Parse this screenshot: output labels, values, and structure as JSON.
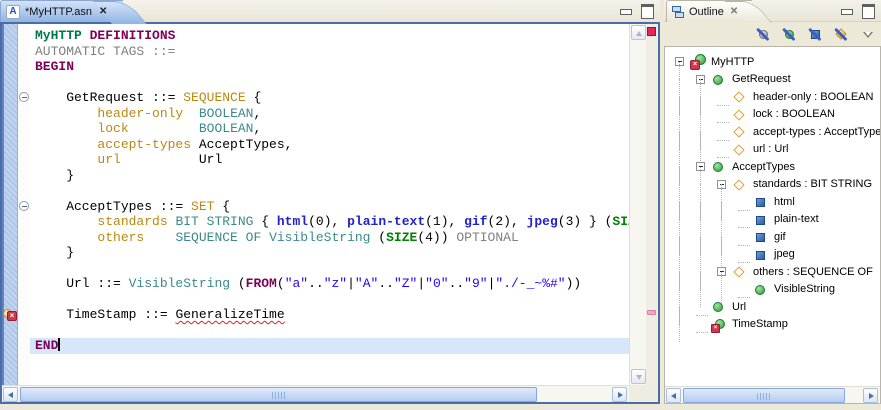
{
  "editor": {
    "tab_title": "*MyHTTP.asn",
    "file_icon_letter": "A",
    "current_line": 20,
    "fold_lines": [
      4,
      11
    ],
    "error_line": 18,
    "code_lines": [
      [
        [
          "mod",
          "MyHTTP"
        ],
        [
          "plain",
          " "
        ],
        [
          "kw",
          "DEFINITIONS"
        ]
      ],
      [
        [
          "gray",
          "AUTOMATIC TAGS ::="
        ]
      ],
      [
        [
          "kw",
          "BEGIN"
        ]
      ],
      [],
      [
        [
          "plain",
          "    GetRequest ::= "
        ],
        [
          "field",
          "SEQUENCE"
        ],
        [
          "plain",
          " {"
        ]
      ],
      [
        [
          "plain",
          "        "
        ],
        [
          "field",
          "header-only"
        ],
        [
          "plain",
          "  "
        ],
        [
          "type",
          "BOOLEAN"
        ],
        [
          "plain",
          ","
        ]
      ],
      [
        [
          "plain",
          "        "
        ],
        [
          "field",
          "lock"
        ],
        [
          "plain",
          "         "
        ],
        [
          "type",
          "BOOLEAN"
        ],
        [
          "plain",
          ","
        ]
      ],
      [
        [
          "plain",
          "        "
        ],
        [
          "field",
          "accept-types"
        ],
        [
          "plain",
          " AcceptTypes,"
        ]
      ],
      [
        [
          "plain",
          "        "
        ],
        [
          "field",
          "url"
        ],
        [
          "plain",
          "          Url"
        ]
      ],
      [
        [
          "plain",
          "    }"
        ]
      ],
      [],
      [
        [
          "plain",
          "    AcceptTypes ::= "
        ],
        [
          "field",
          "SET"
        ],
        [
          "plain",
          " {"
        ]
      ],
      [
        [
          "plain",
          "        "
        ],
        [
          "field",
          "standards"
        ],
        [
          "plain",
          " "
        ],
        [
          "type",
          "BIT STRING"
        ],
        [
          "plain",
          " { "
        ],
        [
          "val",
          "html"
        ],
        [
          "plain",
          "(0), "
        ],
        [
          "val",
          "plain-text"
        ],
        [
          "plain",
          "(1), "
        ],
        [
          "val",
          "gif"
        ],
        [
          "plain",
          "(2), "
        ],
        [
          "val",
          "jpeg"
        ],
        [
          "plain",
          "(3) } ("
        ],
        [
          "size",
          "SIZE"
        ],
        [
          "plain",
          "("
        ]
      ],
      [
        [
          "plain",
          "        "
        ],
        [
          "field",
          "others"
        ],
        [
          "plain",
          "    "
        ],
        [
          "type",
          "SEQUENCE OF VisibleString"
        ],
        [
          "plain",
          " ("
        ],
        [
          "size",
          "SIZE"
        ],
        [
          "plain",
          "(4)) "
        ],
        [
          "gray",
          "OPTIONAL"
        ]
      ],
      [
        [
          "plain",
          "    }"
        ]
      ],
      [],
      [
        [
          "plain",
          "    Url ::= "
        ],
        [
          "type",
          "VisibleString"
        ],
        [
          "plain",
          " ("
        ],
        [
          "kw",
          "FROM"
        ],
        [
          "plain",
          "("
        ],
        [
          "str",
          "\"a\""
        ],
        [
          "plain",
          ".."
        ],
        [
          "str",
          "\"z\""
        ],
        [
          "plain",
          "|"
        ],
        [
          "str",
          "\"A\""
        ],
        [
          "plain",
          ".."
        ],
        [
          "str",
          "\"Z\""
        ],
        [
          "plain",
          "|"
        ],
        [
          "str",
          "\"0\""
        ],
        [
          "plain",
          ".."
        ],
        [
          "str",
          "\"9\""
        ],
        [
          "plain",
          "|"
        ],
        [
          "str",
          "\"./-_~%#\""
        ],
        [
          "plain",
          "))"
        ]
      ],
      [],
      [
        [
          "plain",
          "    TimeStamp ::= "
        ],
        [
          "err",
          "GeneralizeTime"
        ]
      ],
      [],
      [
        [
          "kw",
          "END"
        ]
      ]
    ]
  },
  "outline": {
    "title": "Outline",
    "toolbar_icons": [
      "hide-objects-filter-icon",
      "hide-types-filter-icon",
      "hide-values-filter-icon",
      "hide-fields-filter-icon"
    ],
    "tree": [
      {
        "depth": 0,
        "toggle": true,
        "icon": "module-error-icon",
        "label": "MyHTTP"
      },
      {
        "depth": 1,
        "toggle": true,
        "icon": "type-icon",
        "label": "GetRequest"
      },
      {
        "depth": 2,
        "toggle": false,
        "icon": "field-icon",
        "label": "header-only : BOOLEAN"
      },
      {
        "depth": 2,
        "toggle": false,
        "icon": "field-icon",
        "label": "lock : BOOLEAN"
      },
      {
        "depth": 2,
        "toggle": false,
        "icon": "field-icon",
        "label": "accept-types : AcceptTypes"
      },
      {
        "depth": 2,
        "toggle": false,
        "icon": "field-icon",
        "label": "url : Url"
      },
      {
        "depth": 1,
        "toggle": true,
        "icon": "type-icon",
        "label": "AcceptTypes"
      },
      {
        "depth": 2,
        "toggle": true,
        "icon": "field-icon",
        "label": "standards : BIT STRING"
      },
      {
        "depth": 3,
        "toggle": false,
        "icon": "value-icon",
        "label": "html"
      },
      {
        "depth": 3,
        "toggle": false,
        "icon": "value-icon",
        "label": "plain-text"
      },
      {
        "depth": 3,
        "toggle": false,
        "icon": "value-icon",
        "label": "gif"
      },
      {
        "depth": 3,
        "toggle": false,
        "icon": "value-icon",
        "label": "jpeg"
      },
      {
        "depth": 2,
        "toggle": true,
        "icon": "field-icon",
        "label": "others : SEQUENCE OF"
      },
      {
        "depth": 3,
        "toggle": false,
        "icon": "type-icon",
        "label": "VisibleString"
      },
      {
        "depth": 1,
        "toggle": false,
        "icon": "type-icon",
        "label": "Url"
      },
      {
        "depth": 1,
        "toggle": false,
        "icon": "type-error-icon",
        "label": "TimeStamp"
      }
    ]
  },
  "colors": {
    "keyword": "#7F0055",
    "module_name": "#00784B",
    "field_name": "#BB8811",
    "builtin_type": "#3B8A8A",
    "named_value": "#2222CC",
    "string_literal": "#2A00FF",
    "size_keyword": "#007F00",
    "comment_gray": "#7F7F7F",
    "error_red": "#E02020",
    "active_tab_blue": "#8FB4E4",
    "focus_border_blue": "#4A6DA8",
    "current_line_bg": "#D8E6FA"
  }
}
